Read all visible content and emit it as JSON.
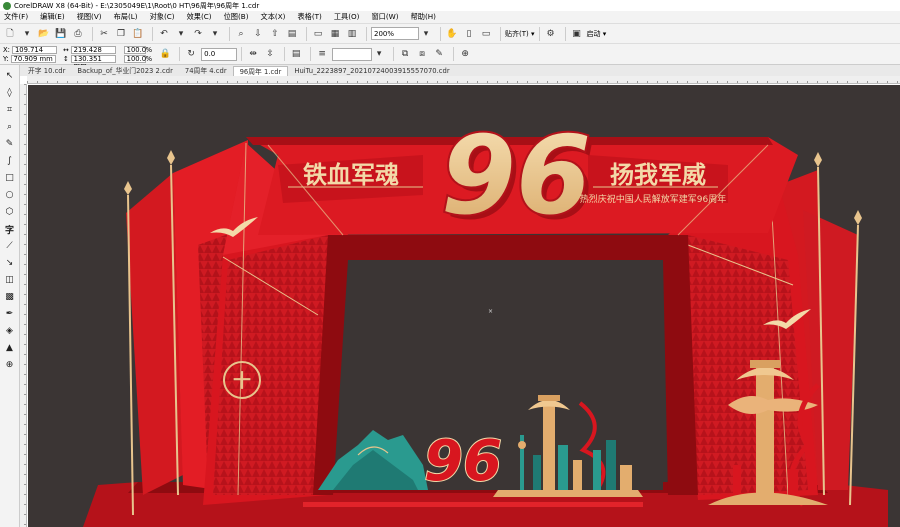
{
  "window": {
    "title": "CorelDRAW X8 (64-Bit) - E:\\2305049E\\1\\Root\\0 HT\\96周年\\96周年  1.cdr"
  },
  "menu": [
    "文件(F)",
    "编辑(E)",
    "视图(V)",
    "布局(L)",
    "对象(C)",
    "效果(C)",
    "位图(B)",
    "文本(X)",
    "表格(T)",
    "工具(O)",
    "窗口(W)",
    "帮助(H)"
  ],
  "toolbar": {
    "zoom": "200%",
    "snap_label": "贴齐(T)",
    "launch_label": "启动"
  },
  "property_bar": {
    "x": "109.714 mm",
    "y": "70.909 mm",
    "width": "219.428 mm",
    "height": "130.351 mm",
    "scale_w": "100.0",
    "scale_h": "100.0",
    "pct": "%",
    "rotation": "0.0"
  },
  "tabs": [
    "开字 10.cdr",
    "Backup_of_华业门2023 2.cdr",
    "74周年 4.cdr",
    "96周年  1.cdr",
    "HuiTu_2223897_20210724003915557070.cdr"
  ],
  "active_tab": 3,
  "artwork": {
    "left_slogan": "铁血军魂",
    "right_slogan": "扬我军威",
    "big_number": "96",
    "subtitle": "热烈庆祝中国人民解放军建军96周年",
    "small_number": "96"
  },
  "colors": {
    "canvas": "#3b3534",
    "red": "#d8161f",
    "dark_red": "#8e0b10",
    "gold": "#e8c48d"
  }
}
